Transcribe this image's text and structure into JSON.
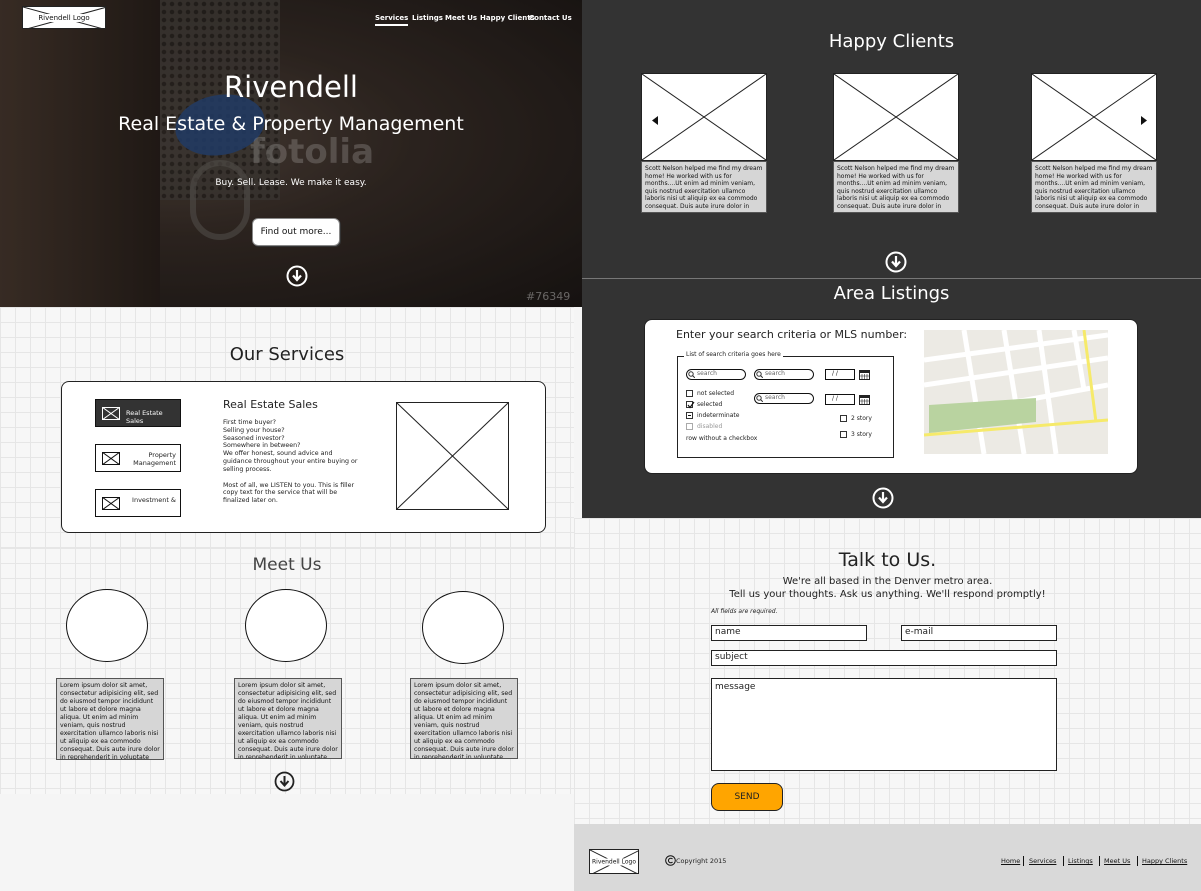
{
  "hero": {
    "logo": "Rivendell Logo",
    "nav": [
      "Services",
      "Listings",
      "Meet Us",
      "Happy Clients",
      "Contact Us"
    ],
    "title": "Rivendell",
    "subtitle": "Real Estate & Property Management",
    "tagline": "Buy. Sell. Lease. We make it easy.",
    "cta": "Find out more...",
    "watermark": "fotolia",
    "image_id": "#76349"
  },
  "services": {
    "heading": "Our Services",
    "tabs": [
      "Real Estate Sales",
      "Property Management",
      "Investment &"
    ],
    "detail_title": "Real Estate Sales",
    "detail_lines": [
      "First time buyer?",
      "Selling your house?",
      "Seasoned investor?",
      "Somewhere in between?",
      "We offer honest, sound advice and",
      "guidance throughout your entire buying or",
      "selling process."
    ],
    "detail_footer": [
      "Most of all, we LISTEN to you.  This is filler",
      "copy text for the service that will be",
      "finalized later on."
    ]
  },
  "meet": {
    "heading": "Meet Us",
    "bios": [
      "Lorem ipsum dolor sit amet, consectetur adipisicing elit, sed do eiusmod tempor incididunt ut labore et dolore magna aliqua. Ut enim ad minim veniam, quis nostrud exercitation ullamco laboris nisi ut aliquip ex ea commodo consequat. Duis aute irure dolor in reprehenderit in voluptate velit esse cillum dolore eu fugiat nulla pariatur",
      "Lorem ipsum dolor sit amet, consectetur adipisicing elit, sed do eiusmod tempor incididunt ut labore et dolore magna aliqua. Ut enim ad minim veniam, quis nostrud exercitation ullamco laboris nisi ut aliquip ex ea commodo consequat. Duis aute irure dolor in reprehenderit in voluptate",
      "Lorem ipsum dolor sit amet, consectetur adipisicing elit, sed do eiusmod tempor incididunt ut labore et dolore magna aliqua. Ut enim ad minim veniam, quis nostrud exercitation ullamco laboris nisi ut aliquip ex ea commodo consequat. Duis aute irure dolor in reprehenderit in voluptate"
    ]
  },
  "clients": {
    "heading": "Happy Clients",
    "testimonial": "Scott Nelson helped me find my dream home! He worked with us for months....Ut enim ad minim veniam, quis nostrud exercitation ullamco laboris nisi ut aliquip ex ea commodo consequat. Duis aute irure dolor in"
  },
  "listings": {
    "heading": "Area Listings",
    "prompt": "Enter your search criteria or MLS number:",
    "group_label": "List of search criteria goes here",
    "search_placeholder": "search",
    "date_placeholder": "/  /",
    "checks": [
      "not selected",
      "selected",
      "indeterminate",
      "disabled"
    ],
    "row_note": "row without a checkbox",
    "story_checks": [
      "2 story",
      "3 story"
    ]
  },
  "contact": {
    "heading": "Talk to Us.",
    "line1": "We're all based in the Denver metro area.",
    "line2": "Tell us your thoughts. Ask us anything. We'll respond promptly!",
    "required": "All fields are required.",
    "name": "name",
    "email": "e-mail",
    "subject": "subject",
    "message": "message",
    "send": "SEND",
    "send_color": "#ffa500"
  },
  "footer": {
    "logo": "Rivendell Logo",
    "copyright": "Copyright 2015",
    "links": [
      "Home",
      "Services",
      "Listings",
      "Meet Us",
      "Happy Clients"
    ]
  }
}
